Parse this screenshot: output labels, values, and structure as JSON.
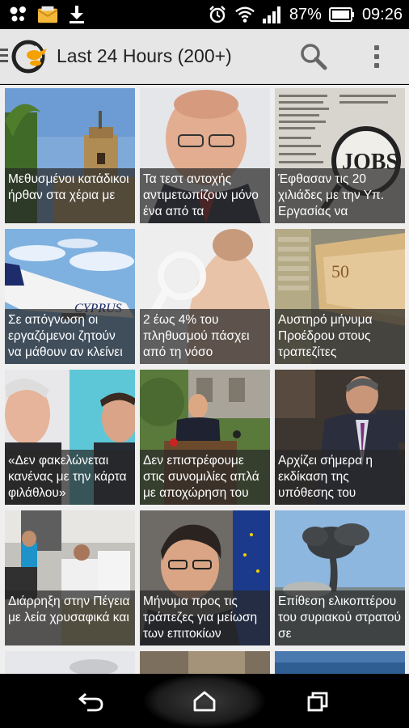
{
  "status_bar": {
    "battery_percent": "87%",
    "time": "09:26",
    "icons": [
      "butterfly-icon",
      "mail-icon",
      "download-icon",
      "alarm-icon",
      "wifi-icon",
      "signal-icon",
      "battery-icon"
    ]
  },
  "action_bar": {
    "title": "Last 24 Hours (200+)",
    "icons": [
      "app-logo-icon",
      "search-icon",
      "overflow-menu-icon"
    ]
  },
  "tiles": [
    {
      "caption": "Μεθυσμένοι κατάδικοι ήρθαν στα χέρια με"
    },
    {
      "caption": "Τα τεστ αντοχής αντιμετωπίζουν μόνο ένα από τα"
    },
    {
      "caption": "Έφθασαν τις 20 χιλιάδες με την Υπ. Εργασίας να"
    },
    {
      "caption": "Σε απόγνωση οι εργαζόμενοι ζητούν να μάθουν αν κλείνει"
    },
    {
      "caption": "2 έως 4% του πληθυσμού πάσχει από τη νόσο"
    },
    {
      "caption": "Αυστηρό μήνυμα Προέδρου στους τραπεζίτες"
    },
    {
      "caption": "«Δεν φακελώνεται κανένας με την κάρτα φιλάθλου»"
    },
    {
      "caption": "Δεν επιστρέφουμε στις συνομιλίες απλά με αποχώρηση του"
    },
    {
      "caption": "Αρχίζει σήμερα η εκδίκαση της υπόθεσης του"
    },
    {
      "caption": "Διάρρηξη στην Πέγεια με λεία χρυσαφικά και"
    },
    {
      "caption": "Μήνυμα προς τις τράπεζες για μείωση των επιτοκίων"
    },
    {
      "caption": "Επίθεση ελικοπτέρου του συριακού στρατού σε"
    }
  ],
  "image_texts": {
    "jobs_sign": "JOBS",
    "aircraft_livery": "CYPRUS"
  },
  "nav_bar": {
    "icons": [
      "back-icon",
      "home-icon",
      "recent-apps-icon"
    ]
  }
}
